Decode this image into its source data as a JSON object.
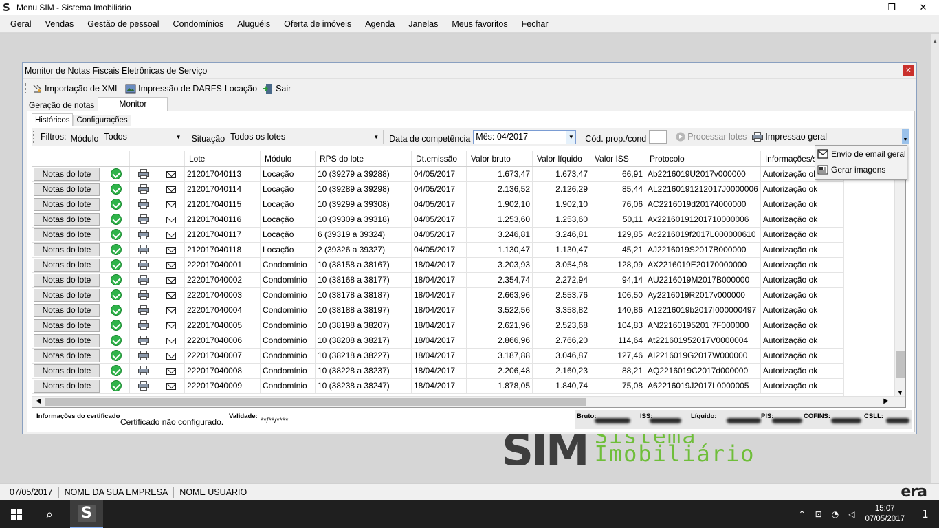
{
  "window": {
    "title": "Menu SIM - Sistema Imobiliário",
    "logo": "S",
    "minimize": "—",
    "maximize": "❐",
    "close": "✕"
  },
  "menu": [
    "Geral",
    "Vendas",
    "Gestão de pessoal",
    "Condomínios",
    "Aluguéis",
    "Oferta de imóveis",
    "Agenda",
    "Janelas",
    "Meus favoritos",
    "Fechar"
  ],
  "monitor": {
    "title": "Monitor de Notas Fiscais Eletrônicas de Serviço",
    "close": "×",
    "toolbar": {
      "import_xml": "Importação de XML",
      "print_darfs": "Impressão de DARFS-Locação",
      "exit": "Sair"
    },
    "tabs": [
      "Geração de notas",
      "Monitor"
    ],
    "subtabs": [
      "Históricos",
      "Configurações"
    ],
    "filters": {
      "label": "Filtros:",
      "modulo_label": "Módulo",
      "modulo_value": "Todos",
      "situacao_label": "Situação",
      "situacao_value": "Todos os lotes",
      "competencia_label": "Data de competência",
      "competencia_value": "Mês: 04/2017",
      "cod_label": "Cód. prop./cond",
      "processar": "Processar lotes",
      "impressao": "Impressao geral"
    },
    "dropdown": [
      "Envio de email geral",
      "Gerar imagens"
    ],
    "columns": [
      "",
      "",
      "",
      "",
      "Lote",
      "Módulo",
      "RPS do lote",
      "Dt.emissão",
      "Valor bruto",
      "Valor líquido",
      "Valor ISS",
      "Protocolo",
      "Informações/situação"
    ],
    "row_button": "Notas do lote",
    "rows": [
      [
        "212017040113",
        "Locação",
        "10 (39279 a 39288)",
        "04/05/2017",
        "1.673,47",
        "1.673,47",
        "66,91",
        "Ab2216019U2017v000000",
        "Autorização ok"
      ],
      [
        "212017040114",
        "Locação",
        "10 (39289 a 39298)",
        "04/05/2017",
        "2.136,52",
        "2.126,29",
        "85,44",
        "AL22160191212017J0000006",
        "Autorização ok"
      ],
      [
        "212017040115",
        "Locação",
        "10 (39299 a 39308)",
        "04/05/2017",
        "1.902,10",
        "1.902,10",
        "76,06",
        "AC2216019d20174000000",
        "Autorização ok"
      ],
      [
        "212017040116",
        "Locação",
        "10 (39309 a 39318)",
        "04/05/2017",
        "1.253,60",
        "1.253,60",
        "50,11",
        "Ax22160191201710000006",
        "Autorização ok"
      ],
      [
        "212017040117",
        "Locação",
        "6 (39319 a 39324)",
        "04/05/2017",
        "3.246,81",
        "3.246,81",
        "129,85",
        "Ac2216019f2017L000000610",
        "Autorização ok"
      ],
      [
        "212017040118",
        "Locação",
        "2 (39326 a 39327)",
        "04/05/2017",
        "1.130,47",
        "1.130,47",
        "45,21",
        "AJ2216019S2017B000000",
        "Autorização ok"
      ],
      [
        "222017040001",
        "Condomínio",
        "10 (38158 a 38167)",
        "18/04/2017",
        "3.203,93",
        "3.054,98",
        "128,09",
        "AX2216019E20170000000",
        "Autorização ok"
      ],
      [
        "222017040002",
        "Condomínio",
        "10 (38168 a 38177)",
        "18/04/2017",
        "2.354,74",
        "2.272,94",
        "94,14",
        "AU2216019M2017B000000",
        "Autorização ok"
      ],
      [
        "222017040003",
        "Condomínio",
        "10 (38178 a 38187)",
        "18/04/2017",
        "2.663,96",
        "2.553,76",
        "106,50",
        "Ay2216019R2017v000000",
        "Autorização ok"
      ],
      [
        "222017040004",
        "Condomínio",
        "10 (38188 a 38197)",
        "18/04/2017",
        "3.522,56",
        "3.358,82",
        "140,86",
        "A12216019b2017I000000497",
        "Autorização ok"
      ],
      [
        "222017040005",
        "Condomínio",
        "10 (38198 a 38207)",
        "18/04/2017",
        "2.621,96",
        "2.523,68",
        "104,83",
        "AN22160195201 7F000000",
        "Autorização ok"
      ],
      [
        "222017040006",
        "Condomínio",
        "10 (38208 a 38217)",
        "18/04/2017",
        "2.866,96",
        "2.766,20",
        "114,64",
        "At221601952017V0000004",
        "Autorização ok"
      ],
      [
        "222017040007",
        "Condomínio",
        "10 (38218 a 38227)",
        "18/04/2017",
        "3.187,88",
        "3.046,87",
        "127,46",
        "AI2216019G2017W000000",
        "Autorização ok"
      ],
      [
        "222017040008",
        "Condomínio",
        "10 (38228 a 38237)",
        "18/04/2017",
        "2.206,48",
        "2.160,23",
        "88,21",
        "AQ2216019C2017d000000",
        "Autorização ok"
      ],
      [
        "222017040009",
        "Condomínio",
        "10 (38238 a 38247)",
        "18/04/2017",
        "1.878,05",
        "1.840,74",
        "75,08",
        "A62216019J2017L0000005",
        "Autorização ok"
      ]
    ],
    "cert": {
      "info_label": "Informações do certificado",
      "info_value": "Certificado não configurado.",
      "validade_label": "Validade:",
      "validade_value": "**/**/****",
      "bruto_label": "Bruto:",
      "iss_label": "ISS:",
      "liquido_label": "Líquido:",
      "pis_label": "PIS:",
      "cofins_label": "COFINS:",
      "csll_label": "CSLL:"
    }
  },
  "watermark": {
    "brand": "SIM",
    "line1": "Sistema",
    "line2": "Imobiliário"
  },
  "status": {
    "date": "07/05/2017",
    "company": "NOME DA SUA EMPRESA",
    "user": "NOME USUARIO",
    "era": "era"
  },
  "taskbar": {
    "app_logo": "S",
    "time": "15:07",
    "date": "07/05/2017",
    "notif": "1"
  }
}
